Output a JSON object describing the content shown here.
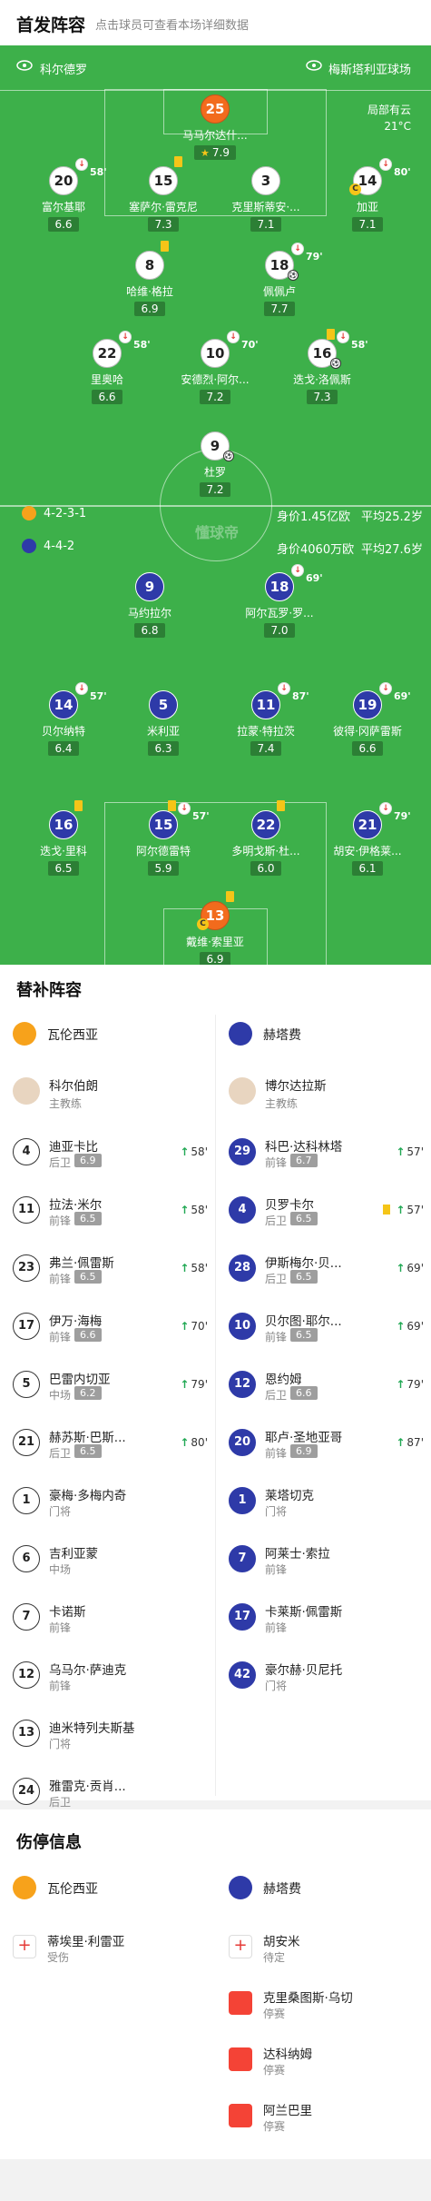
{
  "header": {
    "title": "首发阵容",
    "subtitle": "点击球员可查看本场详细数据"
  },
  "teams": {
    "home": "科尔德罗",
    "away": "梅斯塔利亚球场"
  },
  "weather": {
    "line1": "局部有云",
    "line2": "21°C"
  },
  "home_info": {
    "formation": "4-2-3-1",
    "value": "身价1.45亿欧",
    "age": "平均25.2岁"
  },
  "away_info": {
    "formation": "4-4-2",
    "value": "身价4060万欧",
    "age": "平均27.6岁"
  },
  "watermark": "懂球帝",
  "home_players": [
    {
      "num": "25",
      "name": "马马尔达什...",
      "rating": "7.9"
    },
    {
      "num": "20",
      "name": "富尔基耶",
      "rating": "6.6",
      "sub": "58'"
    },
    {
      "num": "15",
      "name": "塞萨尔·雷克尼",
      "rating": "7.3"
    },
    {
      "num": "3",
      "name": "克里斯蒂安·...",
      "rating": "7.1"
    },
    {
      "num": "14",
      "name": "加亚",
      "rating": "7.1",
      "sub": "80'"
    },
    {
      "num": "8",
      "name": "哈维·格拉",
      "rating": "6.9"
    },
    {
      "num": "18",
      "name": "佩佩卢",
      "rating": "7.7",
      "sub": "79'"
    },
    {
      "num": "22",
      "name": "里奥哈",
      "rating": "6.6",
      "sub": "58'"
    },
    {
      "num": "10",
      "name": "安德烈·阿尔...",
      "rating": "7.2",
      "sub": "70'"
    },
    {
      "num": "16",
      "name": "迭戈·洛佩斯",
      "rating": "7.3",
      "sub": "58'"
    },
    {
      "num": "9",
      "name": "杜罗",
      "rating": "7.2"
    }
  ],
  "away_players": [
    {
      "num": "9",
      "name": "马约拉尔",
      "rating": "6.8"
    },
    {
      "num": "18",
      "name": "阿尔瓦罗·罗...",
      "rating": "7.0",
      "sub": "69'"
    },
    {
      "num": "14",
      "name": "贝尔纳特",
      "rating": "6.4",
      "sub": "57'"
    },
    {
      "num": "5",
      "name": "米利亚",
      "rating": "6.3"
    },
    {
      "num": "11",
      "name": "拉蒙·特拉茨",
      "rating": "7.4",
      "sub": "87'"
    },
    {
      "num": "19",
      "name": "彼得·冈萨雷斯",
      "rating": "6.6",
      "sub": "69'"
    },
    {
      "num": "16",
      "name": "迭戈·里科",
      "rating": "6.5"
    },
    {
      "num": "15",
      "name": "阿尔德雷特",
      "rating": "5.9",
      "sub": "57'"
    },
    {
      "num": "22",
      "name": "多明戈斯·杜...",
      "rating": "6.0"
    },
    {
      "num": "21",
      "name": "胡安·伊格莱...",
      "rating": "6.1",
      "sub": "79'"
    },
    {
      "num": "13",
      "name": "戴维·索里亚",
      "rating": "6.9"
    }
  ],
  "subs_section": {
    "title": "替补阵容",
    "home_team": "瓦伦西亚",
    "away_team": "赫塔费",
    "home_coach": {
      "name": "科尔伯朗",
      "role": "主教练"
    },
    "away_coach": {
      "name": "博尔达拉斯",
      "role": "主教练"
    },
    "home": [
      {
        "num": "4",
        "name": "迪亚卡比",
        "pos": "后卫",
        "rating": "6.9",
        "sub": "58'"
      },
      {
        "num": "11",
        "name": "拉法·米尔",
        "pos": "前锋",
        "rating": "6.5",
        "sub": "58'"
      },
      {
        "num": "23",
        "name": "弗兰·佩雷斯",
        "pos": "前锋",
        "rating": "6.5",
        "sub": "58'"
      },
      {
        "num": "17",
        "name": "伊万·海梅",
        "pos": "前锋",
        "rating": "6.6",
        "sub": "70'"
      },
      {
        "num": "5",
        "name": "巴雷内切亚",
        "pos": "中场",
        "rating": "6.2",
        "sub": "79'"
      },
      {
        "num": "21",
        "name": "赫苏斯·巴斯...",
        "pos": "后卫",
        "rating": "6.5",
        "sub": "80'"
      },
      {
        "num": "1",
        "name": "豪梅·多梅内奇",
        "pos": "门将"
      },
      {
        "num": "6",
        "name": "吉利亚蒙",
        "pos": "中场"
      },
      {
        "num": "7",
        "name": "卡诺斯",
        "pos": "前锋"
      },
      {
        "num": "12",
        "name": "乌马尔·萨迪克",
        "pos": "前锋"
      },
      {
        "num": "13",
        "name": "迪米特列夫斯基",
        "pos": "门将"
      },
      {
        "num": "24",
        "name": "雅雷克·贡肖...",
        "pos": "后卫"
      }
    ],
    "away": [
      {
        "num": "29",
        "name": "科巴·达科林塔",
        "pos": "前锋",
        "rating": "6.7",
        "sub": "57'"
      },
      {
        "num": "4",
        "name": "贝罗卡尔",
        "pos": "后卫",
        "rating": "6.5",
        "sub": "57'",
        "yellow": true
      },
      {
        "num": "28",
        "name": "伊斯梅尔·贝...",
        "pos": "后卫",
        "rating": "6.5",
        "sub": "69'"
      },
      {
        "num": "10",
        "name": "贝尔图·耶尔...",
        "pos": "前锋",
        "rating": "6.5",
        "sub": "69'"
      },
      {
        "num": "12",
        "name": "恩约姆",
        "pos": "后卫",
        "rating": "6.6",
        "sub": "79'"
      },
      {
        "num": "20",
        "name": "耶卢·圣地亚哥",
        "pos": "前锋",
        "rating": "6.9",
        "sub": "87'"
      },
      {
        "num": "1",
        "name": "莱塔切克",
        "pos": "门将"
      },
      {
        "num": "7",
        "name": "阿莱士·索拉",
        "pos": "前锋"
      },
      {
        "num": "17",
        "name": "卡莱斯·佩雷斯",
        "pos": "前锋"
      },
      {
        "num": "42",
        "name": "豪尔赫·贝尼托",
        "pos": "门将"
      }
    ]
  },
  "injury": {
    "title": "伤停信息",
    "home_team": "瓦伦西亚",
    "away_team": "赫塔费",
    "home": [
      {
        "name": "蒂埃里·利雷亚",
        "status": "受伤"
      }
    ],
    "away": [
      {
        "name": "胡安米",
        "status": "待定"
      },
      {
        "name": "克里桑图斯·乌切",
        "status": "停赛"
      },
      {
        "name": "达科纳姆",
        "status": "停赛"
      },
      {
        "name": "阿兰巴里",
        "status": "停赛"
      }
    ]
  }
}
